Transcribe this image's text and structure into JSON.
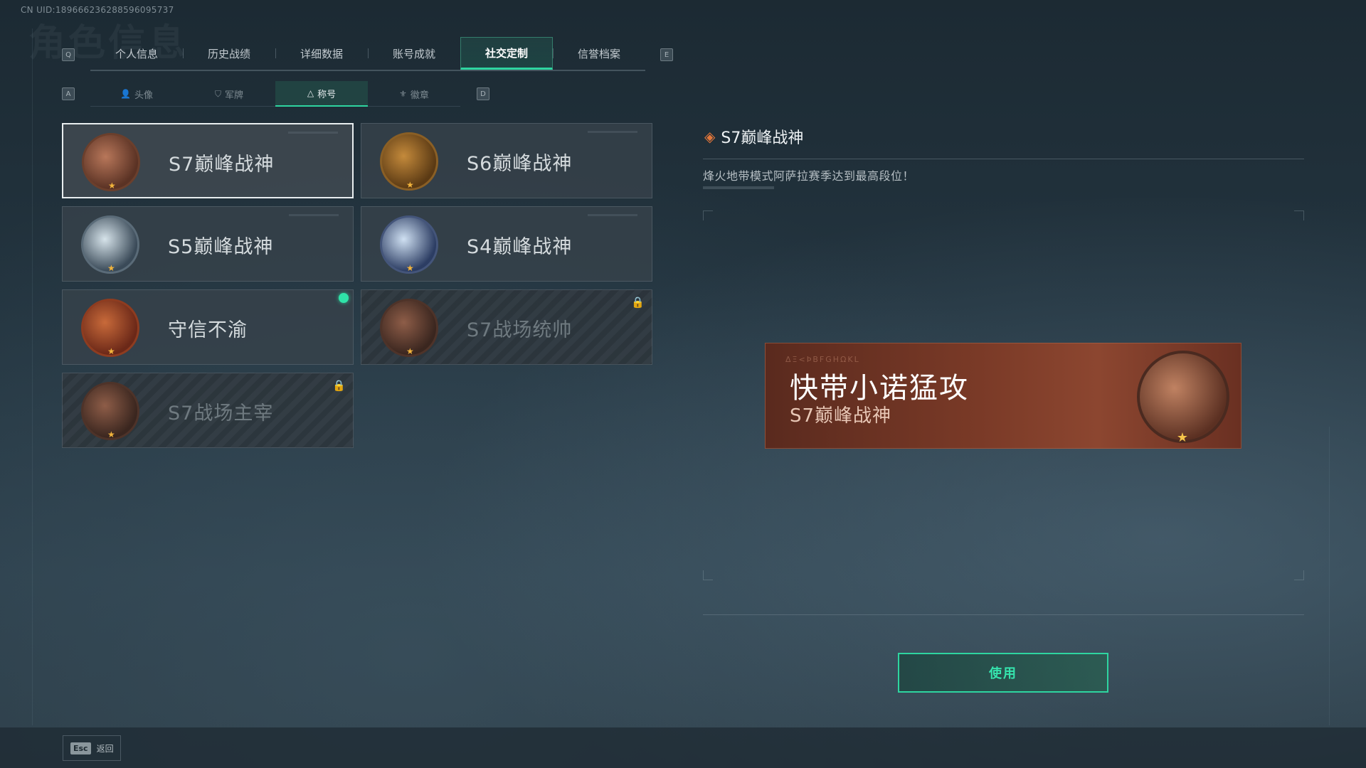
{
  "uid": "CN UID:18966623628859609573​7",
  "header_watermark": "角色信息",
  "tabs": {
    "prev_key": "Q",
    "next_key": "E",
    "items": [
      {
        "label": "个人信息"
      },
      {
        "label": "历史战绩"
      },
      {
        "label": "详细数据"
      },
      {
        "label": "账号成就"
      },
      {
        "label": "社交定制",
        "active": true
      },
      {
        "label": "信誉档案"
      }
    ]
  },
  "subtabs": {
    "prev_key": "A",
    "next_key": "D",
    "items": [
      {
        "label": "头像",
        "icon": "person-icon"
      },
      {
        "label": "军牌",
        "icon": "dogtag-icon"
      },
      {
        "label": "称号",
        "icon": "triangle-icon",
        "active": true
      },
      {
        "label": "徽章",
        "icon": "emblem-icon"
      }
    ]
  },
  "titles": [
    {
      "name": "S7巅峰战神",
      "badge": "gun-badge-copper",
      "state": "selected"
    },
    {
      "name": "S6巅峰战神",
      "badge": "t-emblem-gold",
      "state": "normal"
    },
    {
      "name": "S5巅峰战神",
      "badge": "skull-mask-steel",
      "state": "normal"
    },
    {
      "name": "S4巅峰战神",
      "badge": "helmet-blue",
      "state": "normal"
    },
    {
      "name": "守信不渝",
      "badge": "scales-red",
      "state": "equipped"
    },
    {
      "name": "S7战场统帅",
      "badge": "vehicle-dim",
      "state": "locked"
    },
    {
      "name": "S7战场主宰",
      "badge": "soldier-dim",
      "state": "locked"
    }
  ],
  "detail": {
    "title": "S7巅峰战神",
    "description": "烽火地带模式阿萨拉赛季达到最高段位！",
    "preview": {
      "player_name": "快带小诺猛攻",
      "title": "S7巅峰战神",
      "glyphs": "ΔΞ<ÞΒFGHΩΚL"
    }
  },
  "use_button": "使用",
  "footer": {
    "esc_key": "Esc",
    "back_label": "返回"
  }
}
